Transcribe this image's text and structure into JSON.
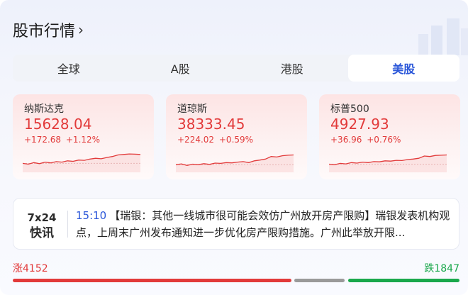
{
  "header": {
    "title": "股市行情",
    "chevron_icon": "chevron-right-icon"
  },
  "tabs": [
    {
      "label": "全球",
      "active": false
    },
    {
      "label": "A股",
      "active": false
    },
    {
      "label": "港股",
      "active": false
    },
    {
      "label": "美股",
      "active": true
    }
  ],
  "indices": [
    {
      "name": "纳斯达克",
      "price": "15628.04",
      "change": "+172.68",
      "change_pct": "+1.12%",
      "trend": [
        0.35,
        0.32,
        0.38,
        0.34,
        0.4,
        0.37,
        0.42,
        0.4,
        0.45,
        0.43,
        0.48,
        0.47,
        0.52,
        0.55,
        0.53,
        0.58,
        0.62,
        0.68,
        0.7,
        0.72,
        0.71,
        0.7
      ]
    },
    {
      "name": "道琼斯",
      "price": "38333.45",
      "change": "+224.02",
      "change_pct": "+0.59%",
      "trend": [
        0.3,
        0.33,
        0.27,
        0.32,
        0.3,
        0.34,
        0.31,
        0.36,
        0.35,
        0.38,
        0.37,
        0.4,
        0.42,
        0.38,
        0.45,
        0.48,
        0.52,
        0.62,
        0.6,
        0.65,
        0.67,
        0.68
      ]
    },
    {
      "name": "标普500",
      "price": "4927.93",
      "change": "+36.96",
      "change_pct": "+0.76%",
      "trend": [
        0.32,
        0.3,
        0.35,
        0.33,
        0.38,
        0.36,
        0.4,
        0.38,
        0.42,
        0.41,
        0.45,
        0.44,
        0.47,
        0.46,
        0.5,
        0.52,
        0.55,
        0.64,
        0.62,
        0.66,
        0.67,
        0.68
      ]
    }
  ],
  "news": {
    "brand_line1": "7x24",
    "brand_line2": "快讯",
    "time": "15:10",
    "text": "【瑞银：其他一线城市很可能会效仿广州放开房产限购】瑞银发表机构观点，上周末广州发布通知进一步优化房产限购措施。广州此举放开限..."
  },
  "breadth": {
    "up_label": "涨4152",
    "down_label": "跌1847",
    "up_fraction": 0.63,
    "flat_fraction": 0.12,
    "colors": {
      "up": "#e23a3a",
      "flat": "#9a9a9a",
      "down": "#1aa84c"
    }
  }
}
